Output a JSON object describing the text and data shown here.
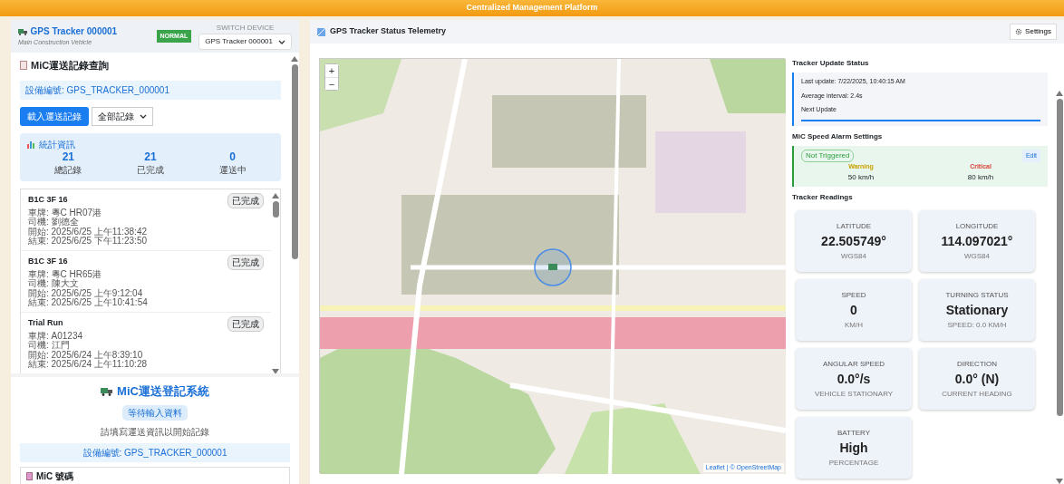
{
  "header": {
    "title": "Centralized Management Platform"
  },
  "device": {
    "name": "GPS Tracker 000001",
    "subtitle": "Main Construction Vehicle",
    "status": "NORMAL",
    "switch_label": "SWITCH DEVICE",
    "selected_device": "GPS Tracker 000001"
  },
  "query": {
    "title": "MiC運送記錄查詢",
    "device_id": "設備編號: GPS_TRACKER_000001",
    "load_button": "載入運送記錄",
    "filter": "全部記錄"
  },
  "stats": {
    "title": "統計資訊",
    "items": [
      {
        "value": "21",
        "label": "總記錄"
      },
      {
        "value": "21",
        "label": "已完成"
      },
      {
        "value": "0",
        "label": "運送中"
      }
    ]
  },
  "records": [
    {
      "title": "B1C 3F 16",
      "badge": "已完成",
      "lines": [
        "車牌: 粵C HR07港",
        "司機: 劉德全",
        "開始: 2025/6/25 上午11:38:42",
        "結束: 2025/6/25 下午11:23:50"
      ]
    },
    {
      "title": "B1C 3F 16",
      "badge": "已完成",
      "lines": [
        "車牌: 粵C HR65港",
        "司機: 陳大文",
        "開始: 2025/6/25 上午9:12:04",
        "結束: 2025/6/25 上午10:41:54"
      ]
    },
    {
      "title": "Trial Run",
      "badge": "已完成",
      "lines": [
        "車牌: A01234",
        "司機: 江門",
        "開始: 2025/6/24 上午8:39:10",
        "結束: 2025/6/24 上午11:10:28"
      ]
    }
  ],
  "registration": {
    "title": "MiC運送登記系統",
    "badge": "等待輸入資料",
    "hint": "請填寫運送資訊以開始記錄",
    "device_id": "設備編號: GPS_TRACKER_000001",
    "section_title": "MiC 號碼"
  },
  "telemetry": {
    "title": "GPS Tracker Status Telemetry",
    "settings_button": "Settings",
    "map": {
      "zoom_in": "+",
      "zoom_out": "−",
      "attribution": "Leaflet | © OpenStreetMap"
    }
  },
  "update_status": {
    "title": "Tracker Update Status",
    "last_update": "Last update: 7/22/2025, 10:40:15 AM",
    "interval": "Average interval: 2.4s",
    "next_label": "Next Update",
    "level": 1
  },
  "alarm": {
    "title": "MiC Speed Alarm Settings",
    "status": "Not Triggered",
    "edit": "Edit",
    "thresholds": [
      {
        "kind": "warning",
        "label": "Warning",
        "value": "50 km/h"
      },
      {
        "kind": "critical",
        "label": "Critical",
        "value": "80 km/h"
      }
    ]
  },
  "readings": {
    "title": "Tracker Readings",
    "cards": [
      {
        "label": "LATITUDE",
        "value": "22.505749°",
        "unit": "WGS84"
      },
      {
        "label": "LONGITUDE",
        "value": "114.097021°",
        "unit": "WGS84"
      },
      {
        "label": "SPEED",
        "value": "0",
        "unit": "KM/H"
      },
      {
        "label": "TURNING STATUS",
        "value": "Stationary",
        "unit": "SPEED: 0.0 KM/H"
      },
      {
        "label": "ANGULAR SPEED",
        "value": "0.0°/s",
        "unit": "VEHICLE STATIONARY"
      },
      {
        "label": "DIRECTION",
        "value": "0.0° (N)",
        "unit": "CURRENT HEADING"
      },
      {
        "label": "BATTERY",
        "value": "High",
        "unit": "PERCENTAGE"
      }
    ]
  }
}
